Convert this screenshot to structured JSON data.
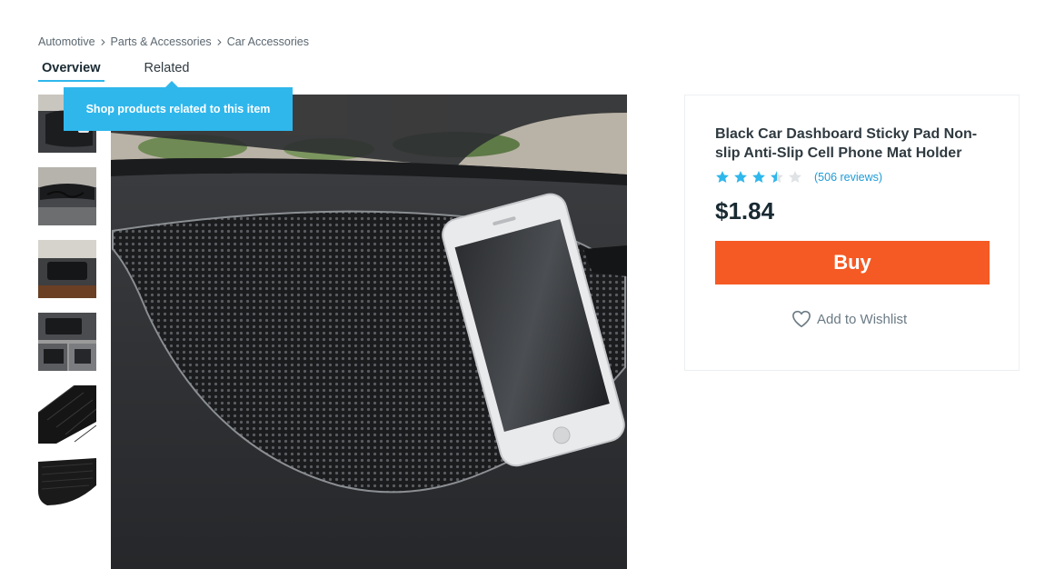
{
  "breadcrumb": {
    "items": [
      "Automotive",
      "Parts & Accessories",
      "Car Accessories"
    ]
  },
  "tabs": {
    "overview": "Overview",
    "related": "Related"
  },
  "tooltip": {
    "text": "Shop products related to this item"
  },
  "product": {
    "title": "Black Car Dashboard Sticky Pad Non-slip Anti-Slip Cell Phone Mat Holder",
    "rating": 3.5,
    "rating_max": 5,
    "reviews": "(506 reviews)",
    "price": "$1.84",
    "buy_label": "Buy",
    "wishlist_label": "Add to Wishlist"
  },
  "thumbnails": {
    "count": 6
  },
  "colors": {
    "accent": "#2fb7ec",
    "buy": "#f55a24",
    "star_filled": "#2fb7ec",
    "star_empty": "#dfe3e6",
    "link": "#1e9bd7"
  },
  "icons": {
    "breadcrumb_separator": "chevron-right-icon",
    "star": "star-icon",
    "wishlist": "heart-icon"
  }
}
